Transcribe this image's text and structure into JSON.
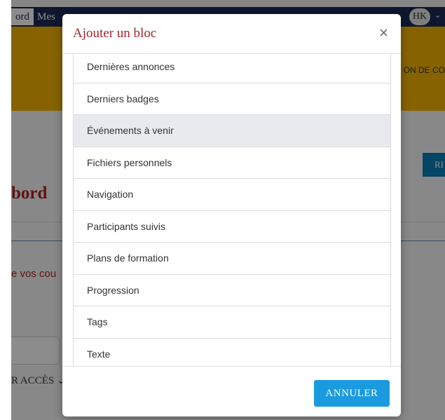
{
  "background": {
    "nav_active": "ord",
    "nav_item": "Mes",
    "avatar_initials": "HK",
    "chevron": "⌄",
    "banner_text": "ON DE CO",
    "blue_button": "RI",
    "page_title": "bord",
    "subtitle": "e vos cou",
    "dropdown_label": "R ACCÈS ⌄",
    "colors": {
      "navbar": "#1d2a57",
      "banner": "#f5b400",
      "accent": "#b22222"
    }
  },
  "modal": {
    "title": "Ajouter un bloc",
    "close_label": "×",
    "blocks": [
      {
        "label": "Dernières annonces"
      },
      {
        "label": "Derniers badges"
      },
      {
        "label": "Événements à venir",
        "hovered": true
      },
      {
        "label": "Fichiers personnels"
      },
      {
        "label": "Navigation"
      },
      {
        "label": "Participants suivis"
      },
      {
        "label": "Plans de formation"
      },
      {
        "label": "Progression"
      },
      {
        "label": "Tags"
      },
      {
        "label": "Texte"
      },
      {
        "label": ""
      }
    ],
    "cancel_label": "ANNULER",
    "colors": {
      "title": "#a4262c",
      "button": "#1a9be0",
      "hover_row": "#e8eaed"
    }
  }
}
